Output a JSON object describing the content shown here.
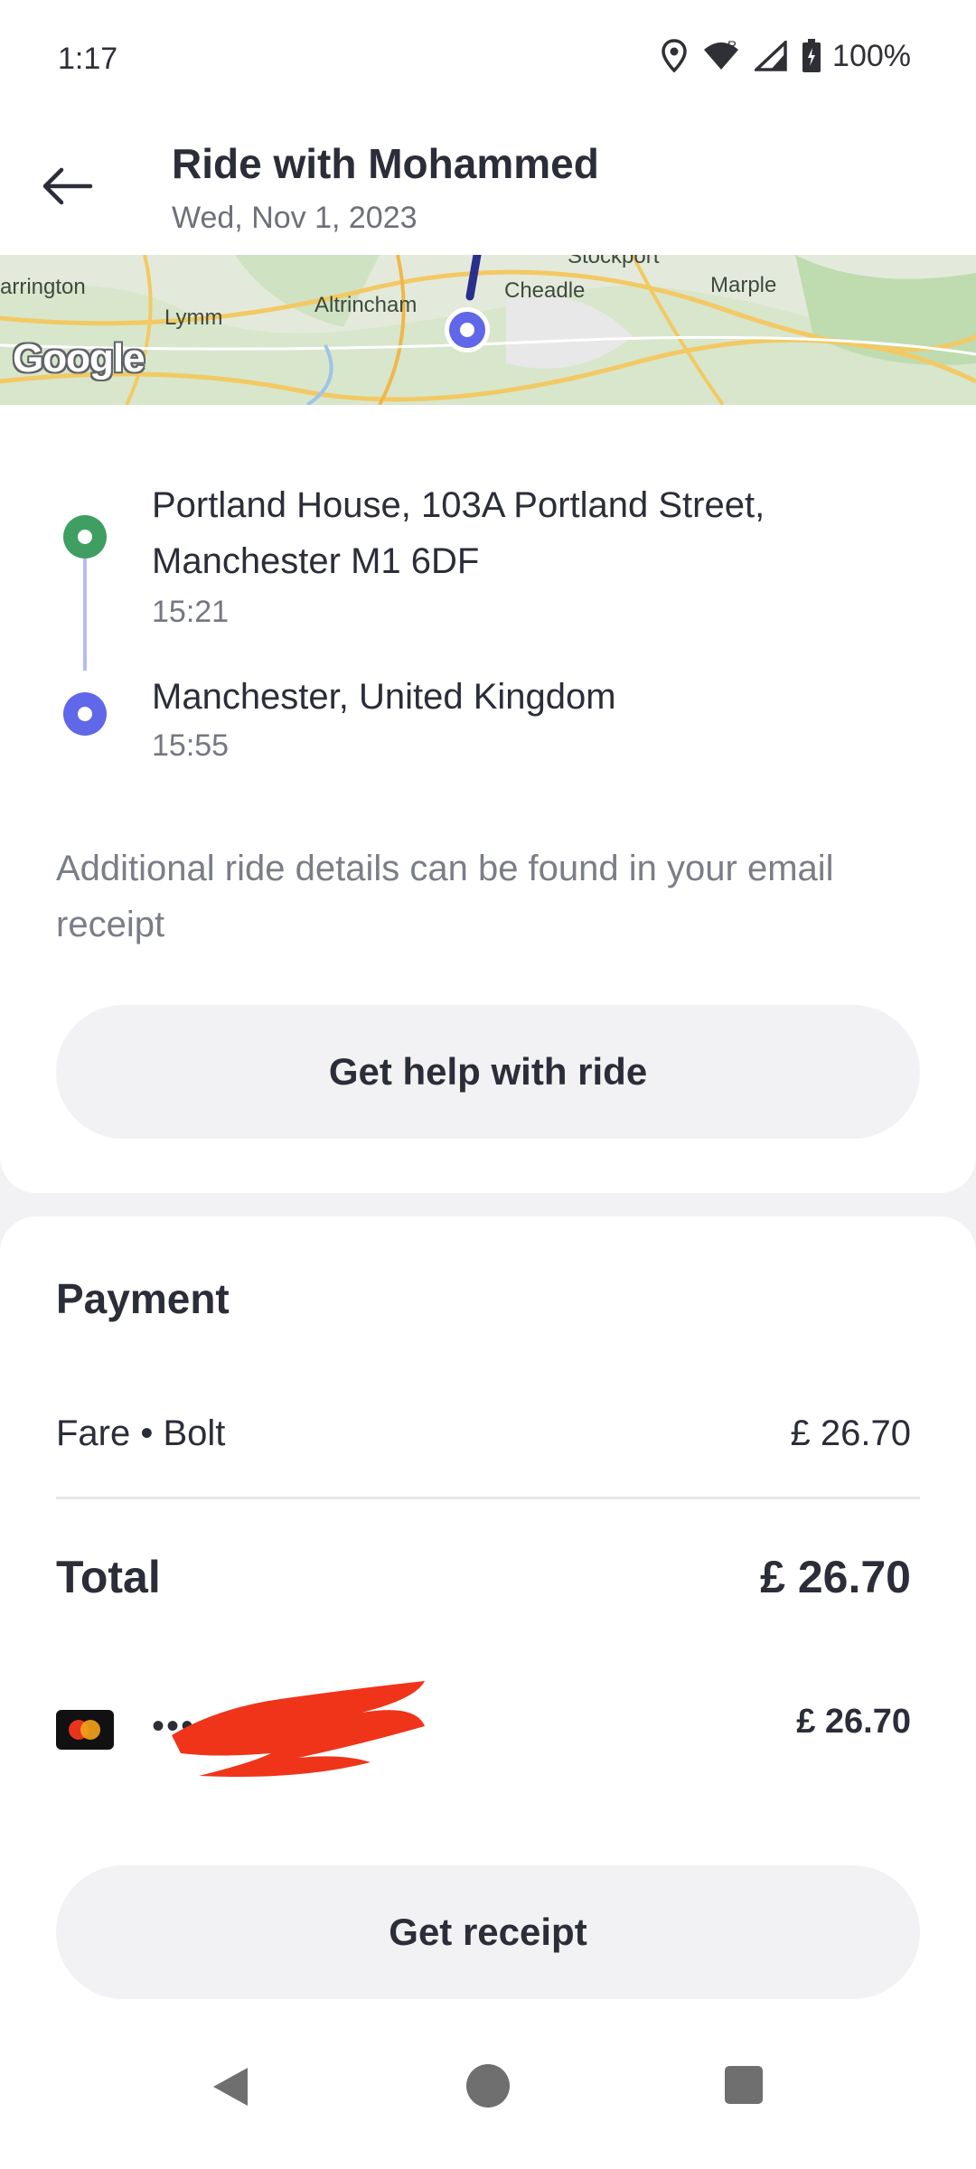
{
  "status_bar": {
    "time": "1:17",
    "battery": "100%",
    "icons": [
      "location-icon",
      "wifi-icon",
      "signal-icon",
      "battery-icon"
    ]
  },
  "header": {
    "title": "Ride with Mohammed",
    "date": "Wed, Nov 1, 2023"
  },
  "map": {
    "labels": [
      "arrington",
      "Lymm",
      "Altrincham",
      "Cheadle",
      "Marple",
      "Stockport"
    ],
    "attribution": "Google"
  },
  "ride": {
    "pickup": {
      "address": "Portland House, 103A Portland Street, Manchester M1 6DF",
      "time": "15:21"
    },
    "dropoff": {
      "address": "Manchester, United Kingdom",
      "time": "15:55"
    },
    "info": "Additional ride details can be found in your email receipt",
    "help_button": "Get help with ride"
  },
  "payment": {
    "title": "Payment",
    "fare_label": "Fare • Bolt",
    "fare_value": "£ 26.70",
    "total_label": "Total",
    "total_value": "£ 26.70",
    "card_mask": "••••",
    "card_amount": "£ 26.70",
    "receipt_button": "Get receipt"
  },
  "colors": {
    "pickup_dot": "#3f9e62",
    "dropoff_dot": "#6067e8",
    "redaction": "#f0341a"
  }
}
